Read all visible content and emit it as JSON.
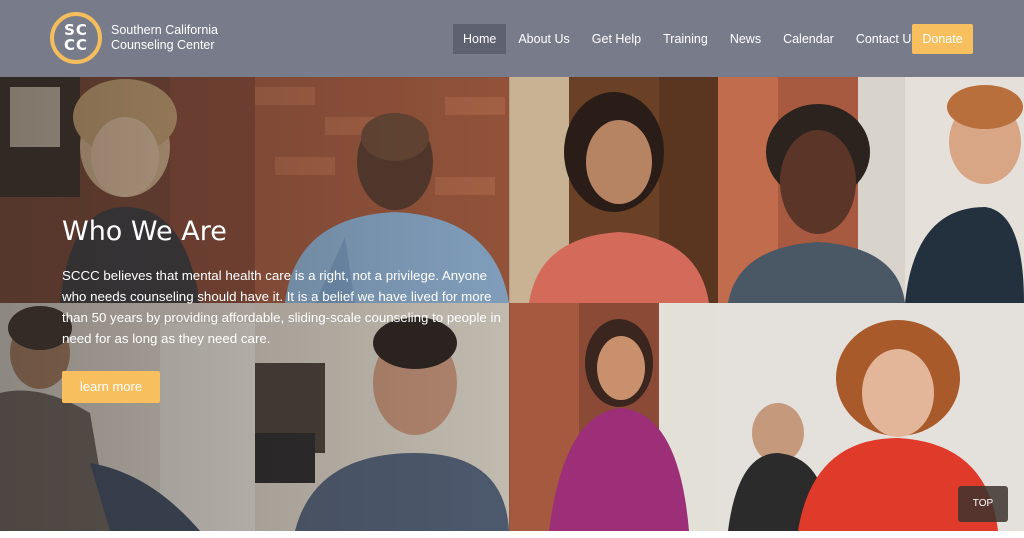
{
  "header": {
    "logo_mark": "SCCC",
    "org_name": "Southern California Counseling Center",
    "nav": [
      {
        "label": "Home",
        "active": true
      },
      {
        "label": "About Us"
      },
      {
        "label": "Get Help"
      },
      {
        "label": "Training"
      },
      {
        "label": "News"
      },
      {
        "label": "Calendar"
      },
      {
        "label": "Contact Us"
      }
    ],
    "donate_label": "Donate"
  },
  "hero": {
    "title": "Who We Are",
    "body": "SCCC believes that mental health care is a right, not a privilege. Anyone who needs counseling should have it. It is a belief we have lived for more than 50 years by providing affordable, sliding-scale counseling to people in need for as long as they need care.",
    "button_label": "learn more"
  },
  "back_to_top_label": "TOP",
  "colors": {
    "header_bg": "#787c8a",
    "nav_active_bg": "#5d6170",
    "accent": "#f7bf5d"
  }
}
